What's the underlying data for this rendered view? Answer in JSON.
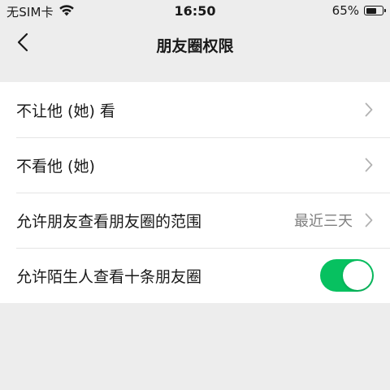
{
  "status_bar": {
    "carrier": "无SIM卡",
    "time": "16:50",
    "battery_percent": "65%",
    "battery_level": 0.65,
    "wifi_icon": "wifi-icon",
    "battery_icon": "battery-icon"
  },
  "nav": {
    "title": "朋友圈权限",
    "back_icon": "chevron-left-icon"
  },
  "settings": {
    "items": [
      {
        "label": "不让他 (她) 看",
        "value": "",
        "control": "chevron"
      },
      {
        "label": "不看他 (她)",
        "value": "",
        "control": "chevron"
      },
      {
        "label": "允许朋友查看朋友圈的范围",
        "value": "最近三天",
        "control": "chevron"
      },
      {
        "label": "允许陌生人查看十条朋友圈",
        "value": "",
        "control": "toggle",
        "toggle_on": true
      }
    ]
  },
  "colors": {
    "background": "#ededed",
    "row_background": "#ffffff",
    "toggle_on": "#07c160",
    "secondary_text": "#7f7f7f",
    "chevron": "#b2b2b2"
  }
}
